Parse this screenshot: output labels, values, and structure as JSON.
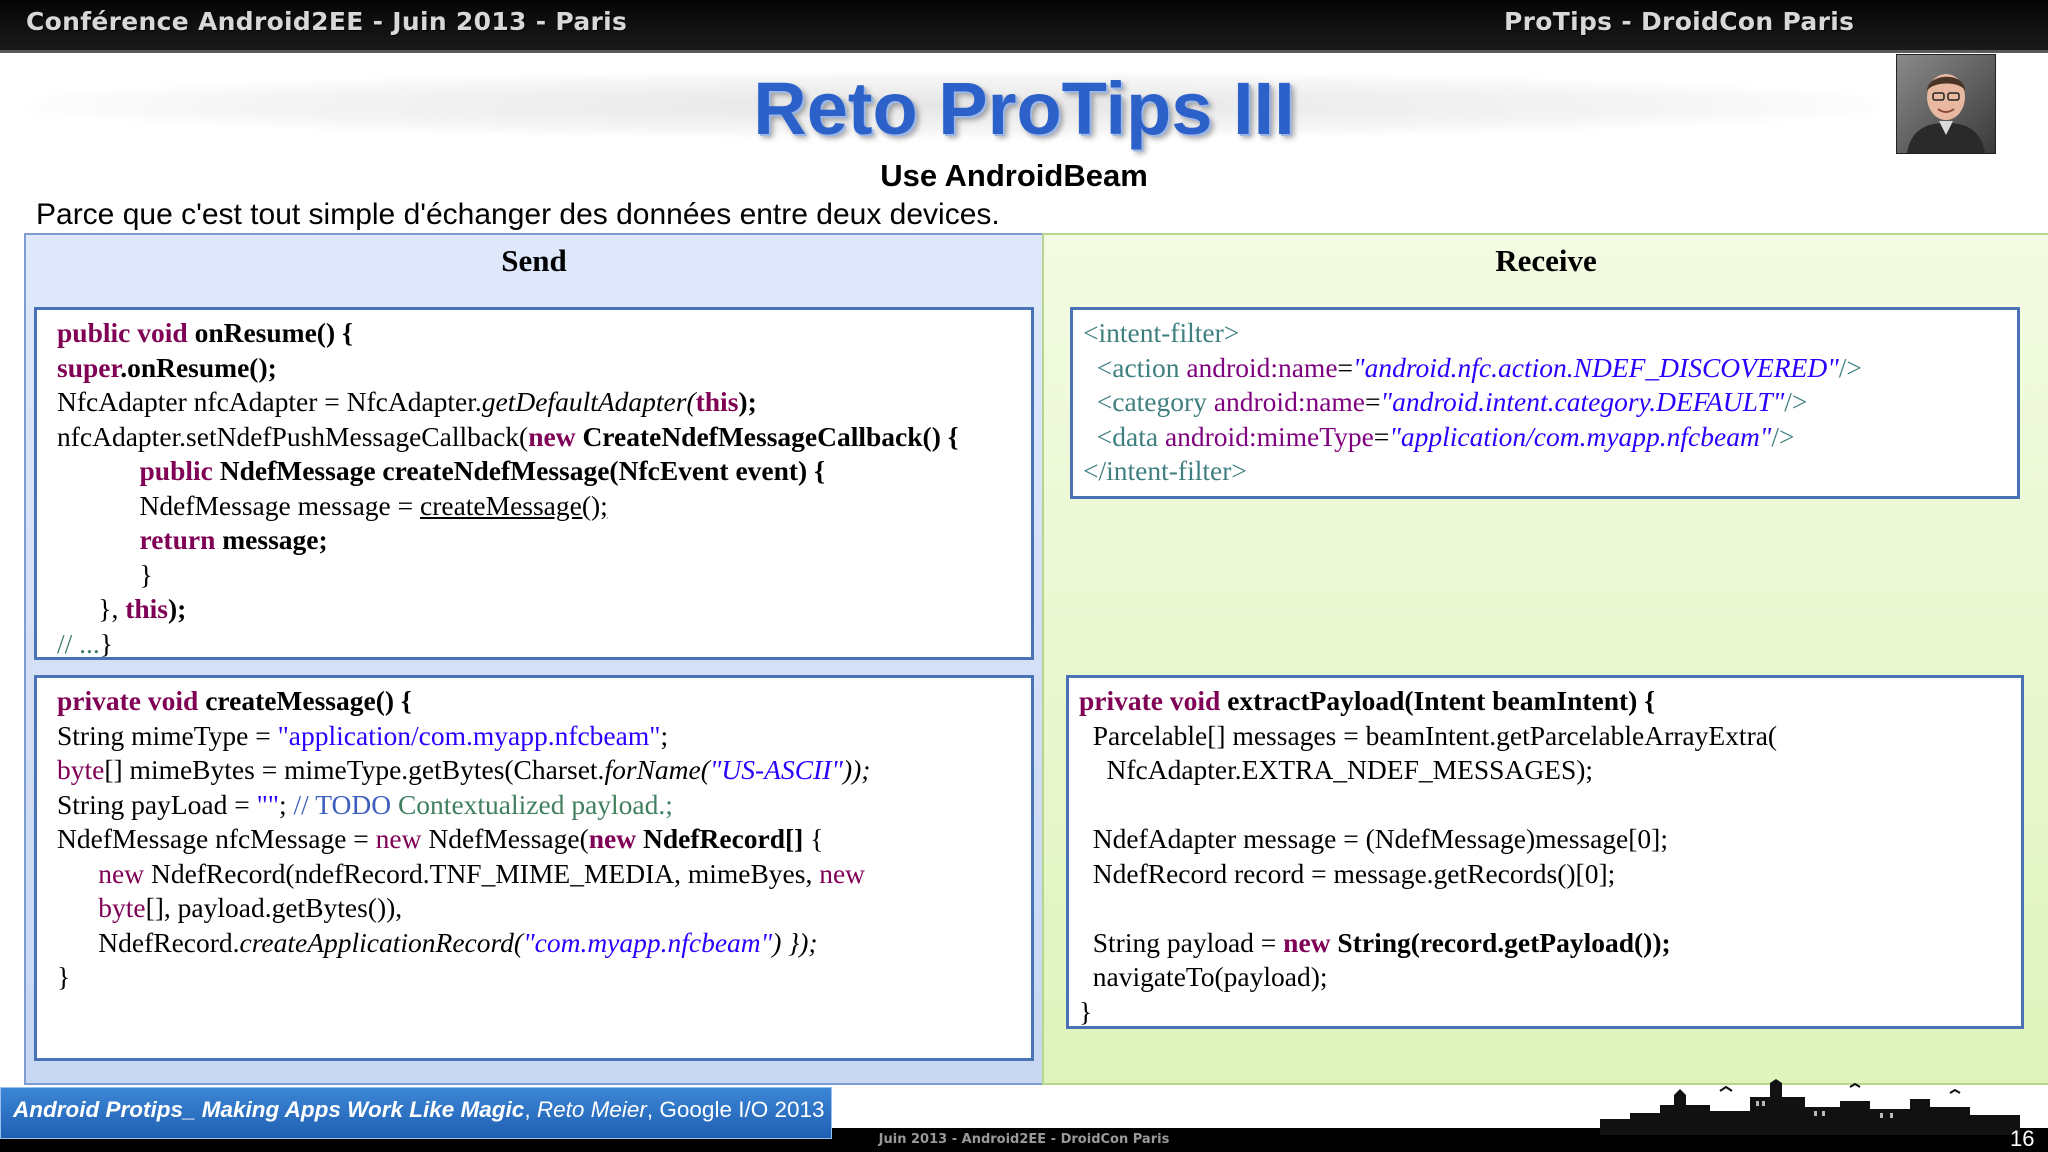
{
  "header": {
    "left": "Conférence Android2EE -  Juin 2013 - Paris",
    "right": "ProTips - DroidCon Paris"
  },
  "title": "Reto ProTips III",
  "subtitle": "Use AndroidBeam",
  "intro": "Parce que c'est tout simple d'échanger des données entre deux devices.",
  "columns": {
    "send": "Send",
    "receive": "Receive"
  },
  "code": {
    "send_top": [
      [
        [
          "kw",
          "public void "
        ],
        [
          "b",
          "onResume() {"
        ]
      ],
      [
        [
          "kw",
          "super"
        ],
        [
          "b",
          ".onResume();"
        ]
      ],
      [
        [
          "",
          "NfcAdapter nfcAdapter = NfcAdapter."
        ],
        [
          "i",
          "getDefaultAdapter("
        ],
        [
          "kw",
          "this"
        ],
        [
          "b",
          ");"
        ]
      ],
      [
        [
          "",
          "nfcAdapter.setNdefPushMessageCallback("
        ],
        [
          "kw",
          "new "
        ],
        [
          "b",
          "CreateNdefMessageCallback() {"
        ]
      ],
      [
        [
          "",
          "            "
        ],
        [
          "kw",
          "public "
        ],
        [
          "b",
          "NdefMessage createNdefMessage(NfcEvent event) {"
        ]
      ],
      [
        [
          "",
          "            NdefMessage message = "
        ],
        [
          "u",
          "createMessage();"
        ]
      ],
      [
        [
          "",
          "            "
        ],
        [
          "kw",
          "return "
        ],
        [
          "b",
          "message;"
        ]
      ],
      [
        [
          "",
          "            }"
        ]
      ],
      [
        [
          "",
          "      }, "
        ],
        [
          "kw",
          "this"
        ],
        [
          "b",
          ");"
        ]
      ],
      [
        [
          "cmt",
          "// ..."
        ],
        [
          "",
          "}"
        ]
      ]
    ],
    "send_bottom": [
      [
        [
          "kw",
          "private void "
        ],
        [
          "b",
          "createMessage() {"
        ]
      ],
      [
        [
          "",
          "String mimeType = "
        ],
        [
          "str",
          "\"application/com.myapp.nfcbeam\""
        ],
        [
          "",
          ";"
        ]
      ],
      [
        [
          "kwl",
          "byte"
        ],
        [
          "",
          "[] mimeBytes = mimeType.getBytes(Charset."
        ],
        [
          "i",
          "forName("
        ],
        [
          "stri",
          "\"US-ASCII\""
        ],
        [
          "i",
          "));"
        ]
      ],
      [
        [
          "",
          "String payLoad = "
        ],
        [
          "str",
          "\"\""
        ],
        [
          "",
          "; "
        ],
        [
          "cmtb",
          "// TODO "
        ],
        [
          "cmt",
          "Contextualized payload.;"
        ]
      ],
      [
        [
          "",
          "NdefMessage nfcMessage = "
        ],
        [
          "kwl",
          "new "
        ],
        [
          "",
          "NdefMessage("
        ],
        [
          "kw",
          "new "
        ],
        [
          "b",
          "NdefRecord[] "
        ],
        [
          "",
          "{"
        ]
      ],
      [
        [
          "",
          "      "
        ],
        [
          "kwl",
          "new "
        ],
        [
          "",
          "NdefRecord(ndefRecord.TNF_MIME_MEDIA, mimeByes, "
        ],
        [
          "kwl",
          "new"
        ]
      ],
      [
        [
          "",
          "      "
        ],
        [
          "kwl",
          "byte"
        ],
        [
          "",
          "[], payload.getBytes()),"
        ]
      ],
      [
        [
          "",
          "      NdefRecord."
        ],
        [
          "i",
          "createApplicationRecord("
        ],
        [
          "stri",
          "\"com.myapp.nfcbeam\""
        ],
        [
          "i",
          ") });"
        ]
      ],
      [
        [
          "",
          "}"
        ]
      ]
    ],
    "receive_top": [
      [
        [
          "tag",
          "<intent-filter>"
        ]
      ],
      [
        [
          "tag",
          "  <action "
        ],
        [
          "attr",
          "android:name"
        ],
        [
          "",
          "="
        ],
        [
          "stri",
          "\"android.nfc.action.NDEF_DISCOVERED\""
        ],
        [
          "tag",
          "/>"
        ]
      ],
      [
        [
          "tag",
          "  <category "
        ],
        [
          "attr",
          "android:name"
        ],
        [
          "",
          "="
        ],
        [
          "stri",
          "\"android.intent.category.DEFAULT\""
        ],
        [
          "tag",
          "/>"
        ]
      ],
      [
        [
          "tag",
          "  <data "
        ],
        [
          "attr",
          "android:mimeType"
        ],
        [
          "",
          "="
        ],
        [
          "stri",
          "\"application/com.myapp.nfcbeam\""
        ],
        [
          "tag",
          "/>"
        ]
      ],
      [
        [
          "tag",
          "</intent-filter>"
        ]
      ]
    ],
    "receive_bottom": [
      [
        [
          "kw",
          "private void "
        ],
        [
          "b",
          "extractPayload(Intent beamIntent) {"
        ]
      ],
      [
        [
          "",
          "  Parcelable[] messages = beamIntent.getParcelableArrayExtra("
        ]
      ],
      [
        [
          "",
          "    NfcAdapter.EXTRA_NDEF_MESSAGES);"
        ]
      ],
      [
        [
          "",
          ""
        ]
      ],
      [
        [
          "",
          "  NdefAdapter message = (NdefMessage)message[0];"
        ]
      ],
      [
        [
          "",
          "  NdefRecord record = message.getRecords()[0];"
        ]
      ],
      [
        [
          "",
          ""
        ]
      ],
      [
        [
          "",
          "  String payload = "
        ],
        [
          "kw",
          "new "
        ],
        [
          "b",
          "String(record.getPayload());"
        ]
      ],
      [
        [
          "",
          "  navigateTo(payload);"
        ]
      ],
      [
        [
          "",
          "}"
        ]
      ]
    ]
  },
  "citation": {
    "title": "Android Protips_ Making Apps Work Like Magic",
    "author": "Reto Meier",
    "event": "Google I/O 2013",
    "sep1": ", ",
    "sep2": ", "
  },
  "footer_text": "Juin 2013 - Android2EE - DroidCon Paris",
  "page_number": "16"
}
